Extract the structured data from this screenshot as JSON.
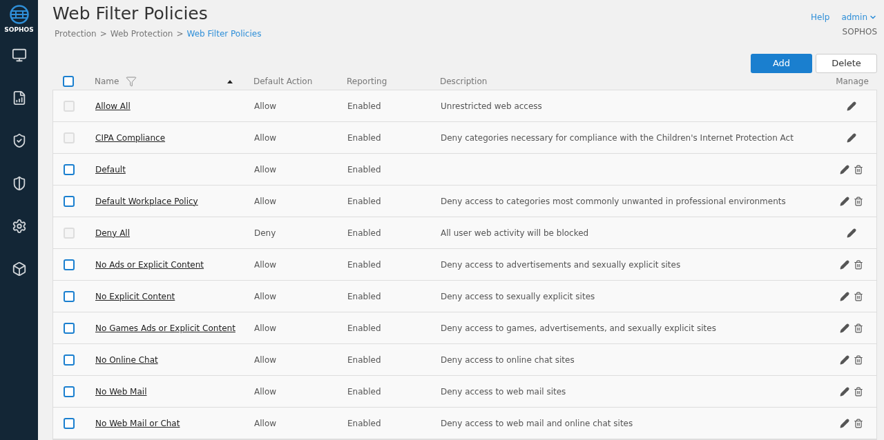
{
  "sidebar": {
    "logo_text": "SOPHOS",
    "items": [
      {
        "kind": "monitor",
        "selected": false
      },
      {
        "kind": "report",
        "selected": false
      },
      {
        "kind": "shield",
        "selected": false
      },
      {
        "kind": "protect",
        "selected": false
      },
      {
        "kind": "gear",
        "selected": false
      },
      {
        "kind": "box",
        "selected": false
      }
    ]
  },
  "header": {
    "title": "Web Filter Policies",
    "breadcrumb": [
      "Protection",
      "Web Protection",
      "Web Filter Policies"
    ],
    "separator": ">",
    "help": "Help",
    "user": "admin",
    "org": "SOPHOS"
  },
  "actions": [
    "Add",
    "Delete"
  ],
  "table": {
    "header_checked": false,
    "columns": [
      "Name",
      "Default Action",
      "Reporting",
      "Description",
      "Manage"
    ],
    "rows": [
      {
        "name": "Allow All",
        "action": "Allow",
        "reporting": "Enabled",
        "description": "Unrestricted web access",
        "disabled": true,
        "checked": false
      },
      {
        "name": "CIPA Compliance",
        "action": "Allow",
        "reporting": "Enabled",
        "description": "Deny categories necessary for compliance with the Children's Internet Protection Act",
        "disabled": true,
        "checked": false
      },
      {
        "name": "Default",
        "action": "Allow",
        "reporting": "Enabled",
        "description": "",
        "disabled": false,
        "checked": false
      },
      {
        "name": "Default Workplace Policy",
        "action": "Allow",
        "reporting": "Enabled",
        "description": "Deny access to categories most commonly unwanted in professional environments",
        "disabled": false,
        "checked": false
      },
      {
        "name": "Deny All",
        "action": "Deny",
        "reporting": "Enabled",
        "description": "All user web activity will be blocked",
        "disabled": true,
        "checked": false
      },
      {
        "name": "No Ads or Explicit Content",
        "action": "Allow",
        "reporting": "Enabled",
        "description": "Deny access to advertisements and sexually explicit sites",
        "disabled": false,
        "checked": false
      },
      {
        "name": "No Explicit Content",
        "action": "Allow",
        "reporting": "Enabled",
        "description": "Deny access to sexually explicit sites",
        "disabled": false,
        "checked": false
      },
      {
        "name": "No Games Ads or Explicit Content",
        "action": "Allow",
        "reporting": "Enabled",
        "description": "Deny access to games, advertisements, and sexually explicit sites",
        "disabled": false,
        "checked": false
      },
      {
        "name": "No Online Chat",
        "action": "Allow",
        "reporting": "Enabled",
        "description": "Deny access to online chat sites",
        "disabled": false,
        "checked": false
      },
      {
        "name": "No Web Mail",
        "action": "Allow",
        "reporting": "Enabled",
        "description": "Deny access to web mail sites",
        "disabled": false,
        "checked": false
      },
      {
        "name": "No Web Mail or Chat",
        "action": "Allow",
        "reporting": "Enabled",
        "description": "Deny access to web mail and online chat sites",
        "disabled": false,
        "checked": false
      }
    ]
  }
}
